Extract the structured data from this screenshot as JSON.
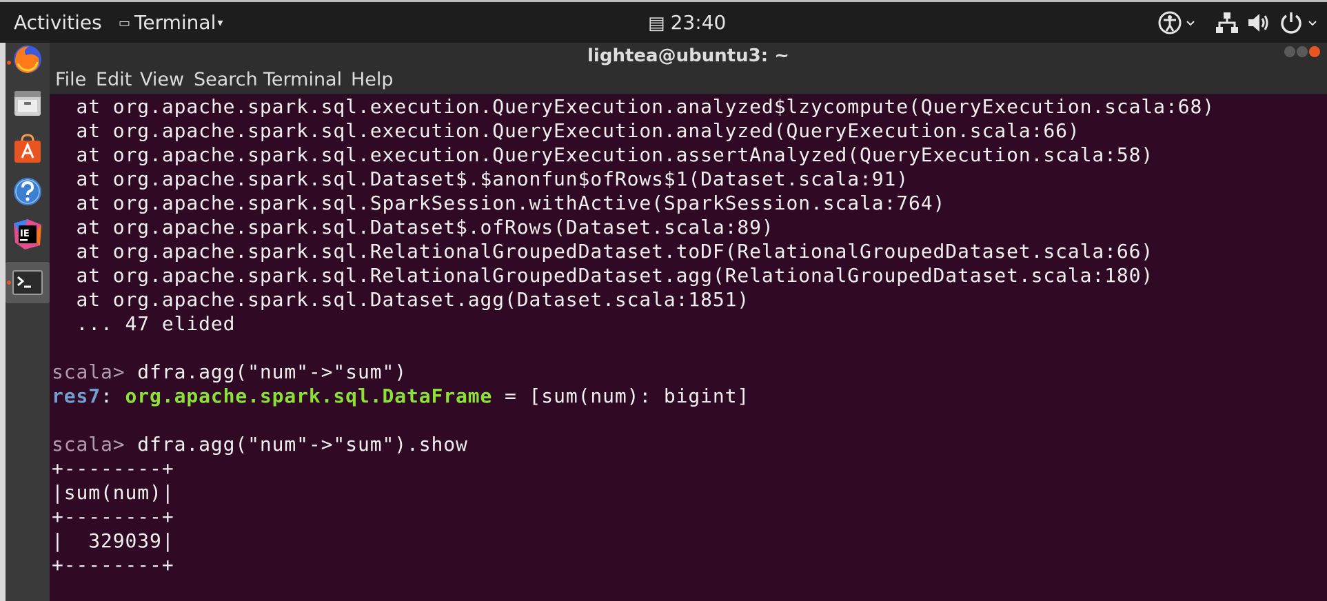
{
  "topbar": {
    "activities": "Activities",
    "app_name": "Terminal",
    "clock": "23:40",
    "tray_icons": [
      "accessibility-icon",
      "network-icon",
      "volume-icon",
      "power-icon"
    ]
  },
  "dock": {
    "apps": [
      "firefox",
      "files",
      "ubuntu-software",
      "help",
      "intellij-idea",
      "terminal"
    ],
    "ide_label": "IE"
  },
  "window": {
    "title": "lightea@ubuntu3: ~",
    "menu": [
      "File",
      "Edit",
      "View",
      "Search",
      "Terminal",
      "Help"
    ]
  },
  "terminal": {
    "stack_lines": [
      "  at org.apache.spark.sql.execution.QueryExecution.analyzed$lzycompute(QueryExecution.scala:68)",
      "  at org.apache.spark.sql.execution.QueryExecution.analyzed(QueryExecution.scala:66)",
      "  at org.apache.spark.sql.execution.QueryExecution.assertAnalyzed(QueryExecution.scala:58)",
      "  at org.apache.spark.sql.Dataset$.$anonfun$ofRows$1(Dataset.scala:91)",
      "  at org.apache.spark.sql.SparkSession.withActive(SparkSession.scala:764)",
      "  at org.apache.spark.sql.Dataset$.ofRows(Dataset.scala:89)",
      "  at org.apache.spark.sql.RelationalGroupedDataset.toDF(RelationalGroupedDataset.scala:66)",
      "  at org.apache.spark.sql.RelationalGroupedDataset.agg(RelationalGroupedDataset.scala:180)",
      "  at org.apache.spark.sql.Dataset.agg(Dataset.scala:1851)",
      "  ... 47 elided"
    ],
    "prompt": "scala>",
    "cmd1": " dfra.agg(\"num\"->\"sum\")",
    "res_name": "res7",
    "res_sep": ": ",
    "res_type": "org.apache.spark.sql.DataFrame",
    "res_value": " = [sum(num): bigint]",
    "cmd2": " dfra.agg(\"num\"->\"sum\").show",
    "table_lines": [
      "+--------+",
      "|sum(num)|",
      "+--------+",
      "|  329039|",
      "+--------+"
    ]
  },
  "colors": {
    "terminal_bg": "#300a24",
    "prompt": "#b39bb3",
    "result_name": "#729fcf",
    "result_type": "#8ae234",
    "accent": "#e95420"
  }
}
